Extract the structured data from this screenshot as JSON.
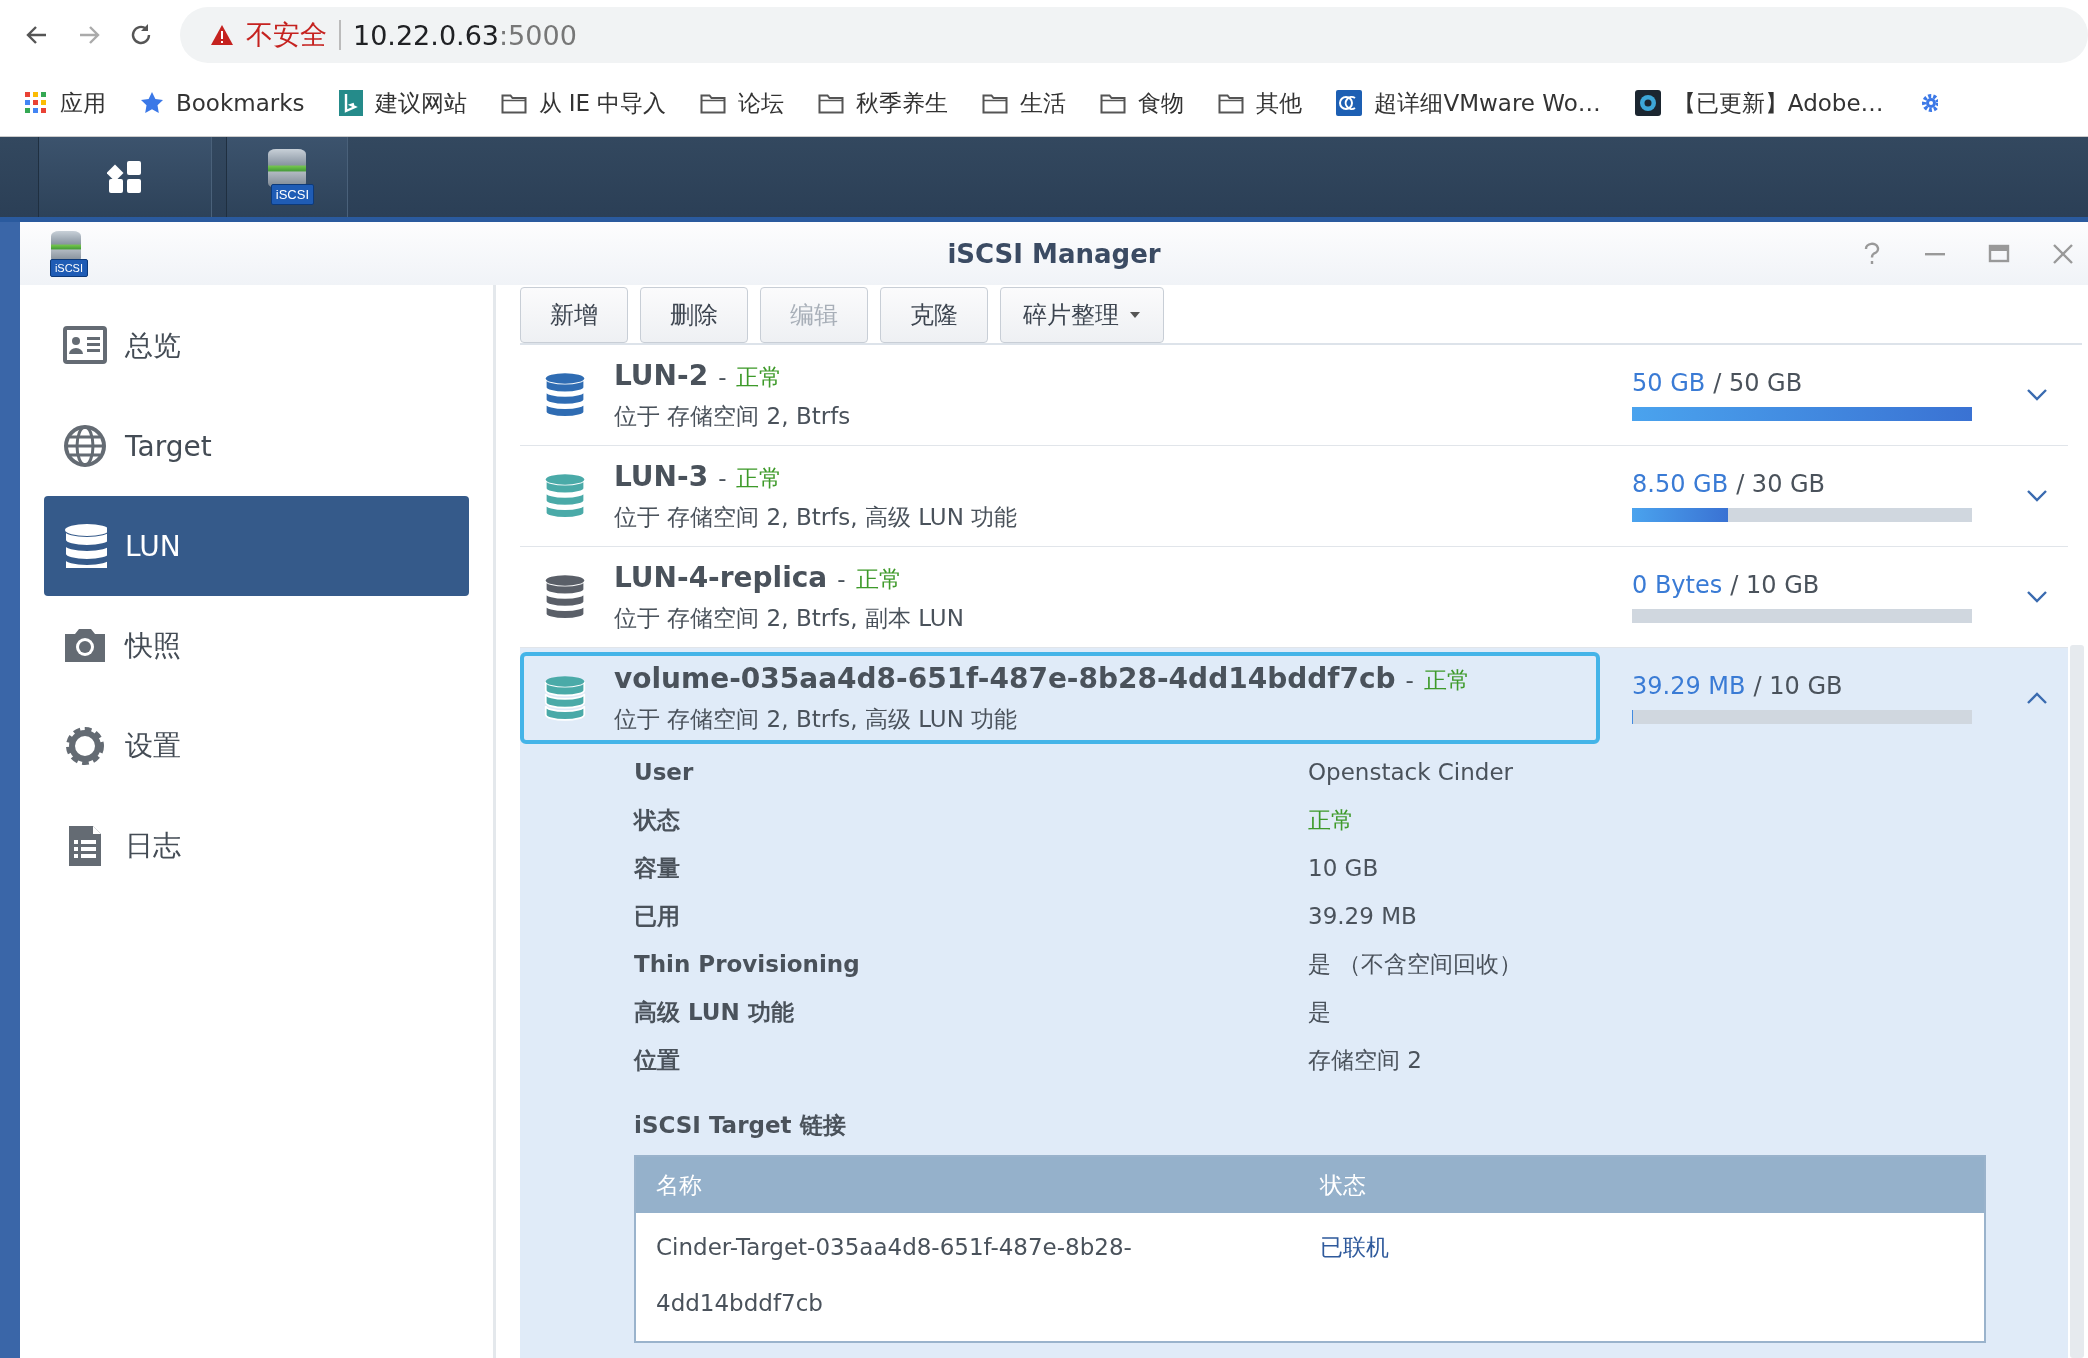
{
  "browser": {
    "address": {
      "security": "不安全",
      "host": "10.22.0.63",
      "port": ":5000"
    },
    "bookmarks": [
      {
        "kind": "apps",
        "label": "应用"
      },
      {
        "kind": "star",
        "label": "Bookmarks"
      },
      {
        "kind": "bing",
        "label": "建议网站"
      },
      {
        "kind": "folder",
        "label": "从 IE 中导入"
      },
      {
        "kind": "folder",
        "label": "论坛"
      },
      {
        "kind": "folder",
        "label": "秋季养生"
      },
      {
        "kind": "folder",
        "label": "生活"
      },
      {
        "kind": "folder",
        "label": "食物"
      },
      {
        "kind": "folder",
        "label": "其他"
      },
      {
        "kind": "pc",
        "label": "超详细VMware Wo…"
      },
      {
        "kind": "site",
        "label": "【已更新】Adobe…"
      },
      {
        "kind": "gear"
      }
    ]
  },
  "taskbar": {
    "apps": [
      {
        "kind": "main-menu"
      },
      {
        "kind": "iscsi",
        "badge": "iSCSI"
      }
    ]
  },
  "window": {
    "title": "iSCSI Manager",
    "badge": "iSCSI"
  },
  "sidebar": {
    "items": [
      {
        "kind": "overview",
        "label": "总览",
        "selected": false
      },
      {
        "kind": "target",
        "label": "Target",
        "selected": false
      },
      {
        "kind": "lun",
        "label": "LUN",
        "selected": true
      },
      {
        "kind": "snapshot",
        "label": "快照",
        "selected": false
      },
      {
        "kind": "settings",
        "label": "设置",
        "selected": false
      },
      {
        "kind": "log",
        "label": "日志",
        "selected": false
      }
    ]
  },
  "toolbar": {
    "buttons": [
      {
        "label": "新增",
        "disabled": false,
        "dropdown": false
      },
      {
        "label": "删除",
        "disabled": false,
        "dropdown": false
      },
      {
        "label": "编辑",
        "disabled": true,
        "dropdown": false
      },
      {
        "label": "克隆",
        "disabled": false,
        "dropdown": false
      },
      {
        "label": "碎片整理",
        "disabled": false,
        "dropdown": true
      }
    ]
  },
  "luns": [
    {
      "name": "LUN-2",
      "dash": "-",
      "status": "正常",
      "location": "位于 存储空间 2, Btrfs",
      "used": "50 GB",
      "of": "/ 50 GB",
      "level": 1,
      "color": "#2f6cb3",
      "expanded": false,
      "selected": false
    },
    {
      "name": "LUN-3",
      "dash": "-",
      "status": "正常",
      "location": "位于 存储空间 2, Btrfs, 高级 LUN 功能",
      "used": "8.50 GB",
      "of": "/ 30 GB",
      "level": 0.283,
      "color": "#4aaaa8",
      "expanded": false,
      "selected": false
    },
    {
      "name": "LUN-4-replica",
      "dash": "-",
      "status": "正常",
      "location": "位于 存储空间 2, Btrfs, 副本 LUN",
      "used": "0 Bytes",
      "of": "/ 10 GB",
      "level": 0,
      "color": "#5a5f68",
      "expanded": false,
      "selected": false
    },
    {
      "name": "volume-035aa4d8-651f-487e-8b28-4dd14bddf7cb",
      "dash": "-",
      "status": "正常",
      "location": "位于 存储空间 2, Btrfs, 高级 LUN 功能",
      "used": "39.29 MB",
      "of": "/ 10 GB",
      "level": 0.004,
      "color": "#4aaaa8",
      "expanded": true,
      "selected": true,
      "details": [
        {
          "label": "User",
          "value": "Openstack Cinder",
          "kind": "plain"
        },
        {
          "label": "状态",
          "value": "正常",
          "kind": "status"
        },
        {
          "label": "容量",
          "value": "10 GB",
          "kind": "plain"
        },
        {
          "label": "已用",
          "value": "39.29 MB",
          "kind": "plain"
        },
        {
          "label": "Thin Provisioning",
          "value": "是 （不含空间回收）",
          "kind": "plain"
        },
        {
          "label": "高级 LUN 功能",
          "value": "是",
          "kind": "plain"
        },
        {
          "label": "位置",
          "value": "存储空间 2",
          "kind": "plain"
        }
      ],
      "targets": {
        "title": "iSCSI Target 链接",
        "columns": [
          "名称",
          "状态"
        ],
        "rows": [
          {
            "name": "Cinder-Target-035aa4d8-651f-487e-8b28-4dd14bddf7cb",
            "status": "已联机"
          }
        ]
      }
    }
  ]
}
